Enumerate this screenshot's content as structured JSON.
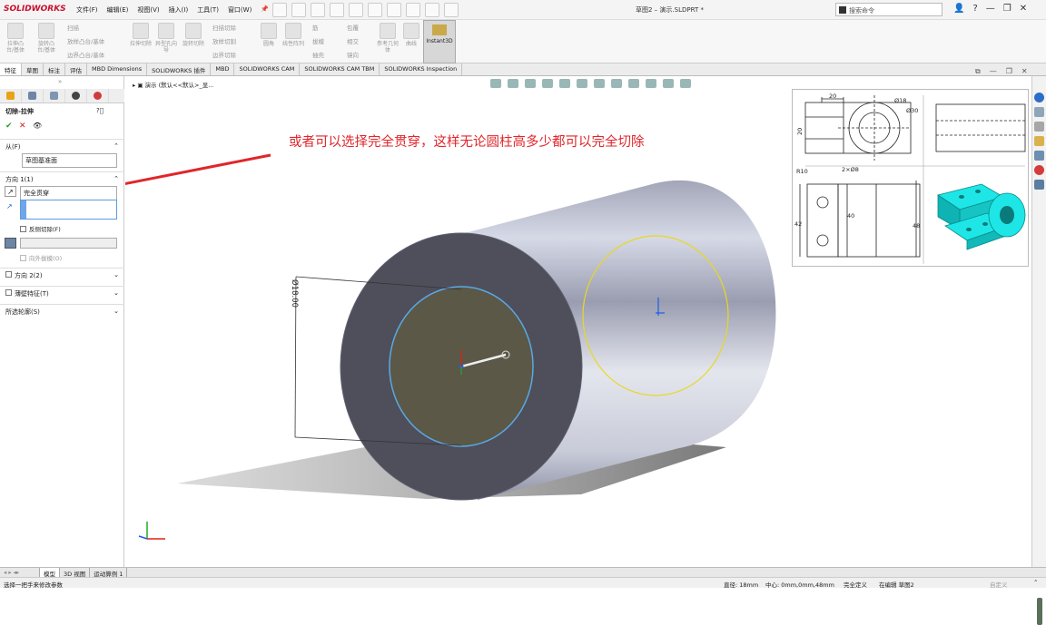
{
  "app": {
    "logo": "SOLIDWORKS",
    "doc_title": "草图2 – 演示.SLDPRT *"
  },
  "menu": [
    "文件(F)",
    "编辑(E)",
    "视图(V)",
    "插入(I)",
    "工具(T)",
    "窗口(W)"
  ],
  "search": {
    "placeholder": "搜索命令"
  },
  "ribbon": {
    "big": [
      "拉伸凸台/基体",
      "旋转凸台/基体",
      "拉伸切除",
      "异型孔向导",
      "旋转切除",
      "圆角",
      "线性阵列",
      "参考几何体",
      "曲线"
    ],
    "small": [
      "扫描",
      "放样凸台/基体",
      "边界凸台/基体",
      "扫描切除",
      "放样切割",
      "边界切除",
      "筋",
      "拔模",
      "抽壳",
      "包覆",
      "相交",
      "镜向"
    ],
    "instant3d": "Instant3D"
  },
  "tabs": [
    "特征",
    "草图",
    "标注",
    "评估",
    "MBD Dimensions",
    "SOLIDWORKS 插件",
    "MBD",
    "SOLIDWORKS CAM",
    "SOLIDWORKS CAM TBM",
    "SOLIDWORKS Inspection"
  ],
  "panel": {
    "title": "切除-拉伸",
    "from_label": "从(F)",
    "from_value": "草图基准面",
    "dir1_label": "方向 1(1)",
    "dir1_value": "完全贯穿",
    "flip": "反侧切除(F)",
    "draft": "向外拔模(O)",
    "dir2_label": "方向 2(2)",
    "thin_label": "薄壁特征(T)",
    "contours_label": "所选轮廓(S)"
  },
  "viewport": {
    "breadcrumb": "演示 (默认<<默认>_显...",
    "annotation": "或者可以选择完全贯穿，这样无论圆柱高多少都可以完全切除",
    "dimension": "Ø18.00"
  },
  "drawing": {
    "d20": "20",
    "d18": "Ø18",
    "d30": "Ø30",
    "d20v": "20",
    "r10": "R10",
    "holes": "2×Ø8",
    "d40": "40",
    "d42": "42",
    "d48": "48"
  },
  "bottom_tabs": [
    "模型",
    "3D 视图",
    "运动算例 1"
  ],
  "status": {
    "left": "选择一把手来修改参数",
    "diameter": "直径: 18mm",
    "center": "中心: 0mm,0mm,48mm",
    "defined": "完全定义",
    "editing": "在编辑 草图2",
    "custom": "自定义"
  },
  "colors": {
    "accent": "#e0262b",
    "cylinder": "#4e4f5a",
    "face": "#5b5847",
    "hole_circle": "#5aa8e6",
    "back_circle": "#e8d820",
    "iso_part": "#1fe6e6"
  }
}
